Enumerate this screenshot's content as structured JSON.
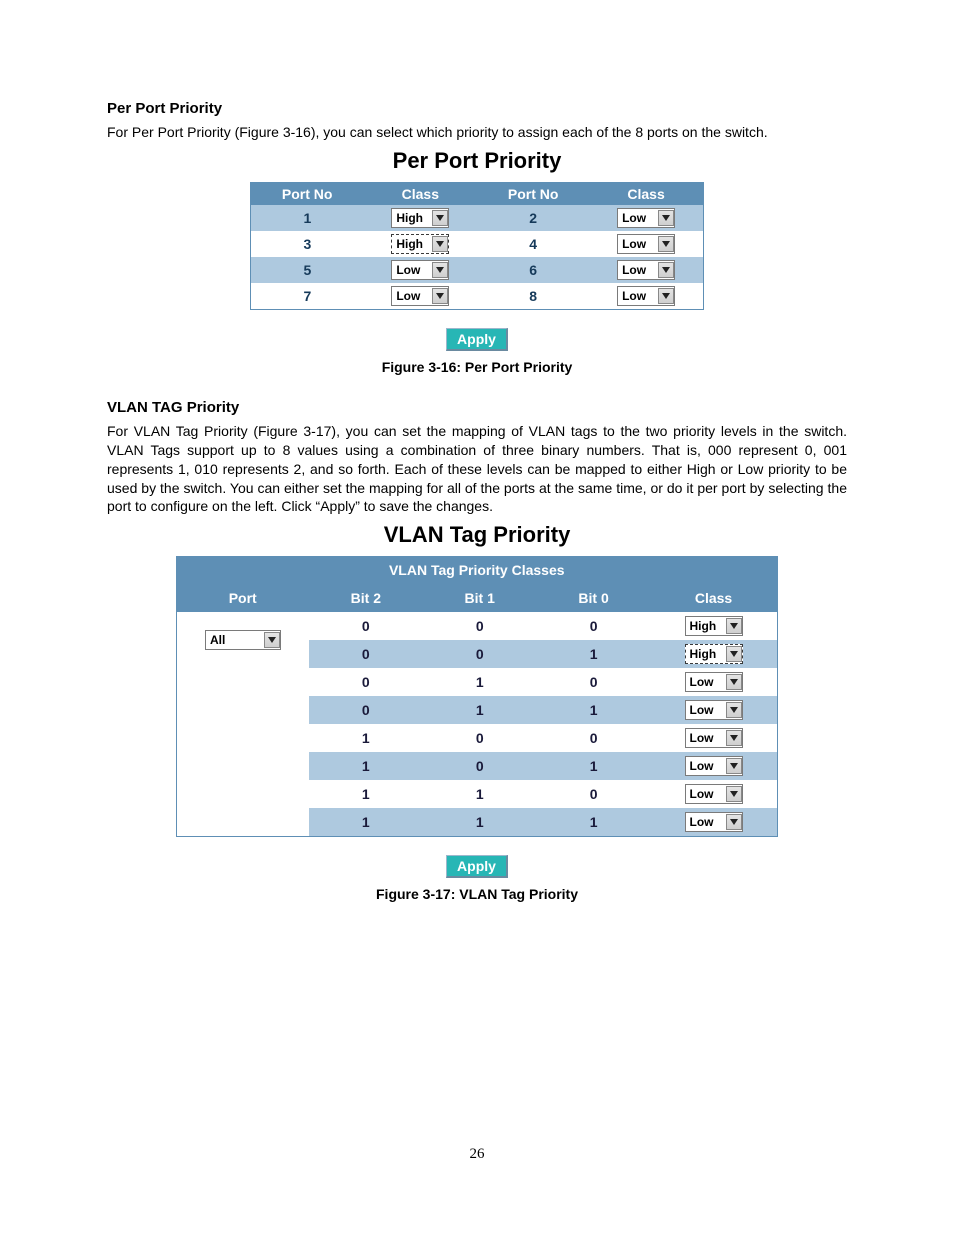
{
  "section1": {
    "title": "Per Port Priority",
    "body": "For Per Port Priority (Figure 3-16), you can select which priority to assign each of the 8 ports on the switch.",
    "panel_title": "Per Port Priority",
    "headers": {
      "port_no": "Port No",
      "class": "Class"
    },
    "rows": [
      {
        "port_a": "1",
        "class_a": "High",
        "port_b": "2",
        "class_b": "Low"
      },
      {
        "port_a": "3",
        "class_a": "High",
        "class_a_dashed": true,
        "port_b": "4",
        "class_b": "Low"
      },
      {
        "port_a": "5",
        "class_a": "Low",
        "port_b": "6",
        "class_b": "Low"
      },
      {
        "port_a": "7",
        "class_a": "Low",
        "port_b": "8",
        "class_b": "Low"
      }
    ],
    "apply": "Apply",
    "caption": "Figure 3-16: Per Port Priority"
  },
  "section2": {
    "title": "VLAN TAG Priority",
    "body": "For VLAN Tag Priority (Figure 3-17), you can set the mapping of VLAN tags to the two priority levels in the switch. VLAN Tags support up to 8 values using a combination of three binary numbers. That is, 000 represent 0, 001 represents 1, 010 represents 2, and so forth. Each of these levels can be mapped to either High or Low priority to be used by the switch. You can either set the mapping for all of the ports at the same time, or do it per port by selecting the port to configure on the left. Click “Apply” to save the changes.",
    "panel_title": "VLAN Tag Priority",
    "super_header": "VLAN Tag Priority Classes",
    "headers": {
      "port": "Port",
      "bit2": "Bit 2",
      "bit1": "Bit 1",
      "bit0": "Bit 0",
      "class": "Class"
    },
    "port_select": "All",
    "rows": [
      {
        "b2": "0",
        "b1": "0",
        "b0": "0",
        "class": "High"
      },
      {
        "b2": "0",
        "b1": "0",
        "b0": "1",
        "class": "High",
        "class_dashed": true
      },
      {
        "b2": "0",
        "b1": "1",
        "b0": "0",
        "class": "Low"
      },
      {
        "b2": "0",
        "b1": "1",
        "b0": "1",
        "class": "Low"
      },
      {
        "b2": "1",
        "b1": "0",
        "b0": "0",
        "class": "Low"
      },
      {
        "b2": "1",
        "b1": "0",
        "b0": "1",
        "class": "Low"
      },
      {
        "b2": "1",
        "b1": "1",
        "b0": "0",
        "class": "Low"
      },
      {
        "b2": "1",
        "b1": "1",
        "b0": "1",
        "class": "Low"
      }
    ],
    "apply": "Apply",
    "caption": "Figure 3-17: VLAN Tag Priority"
  },
  "page_number": "26"
}
